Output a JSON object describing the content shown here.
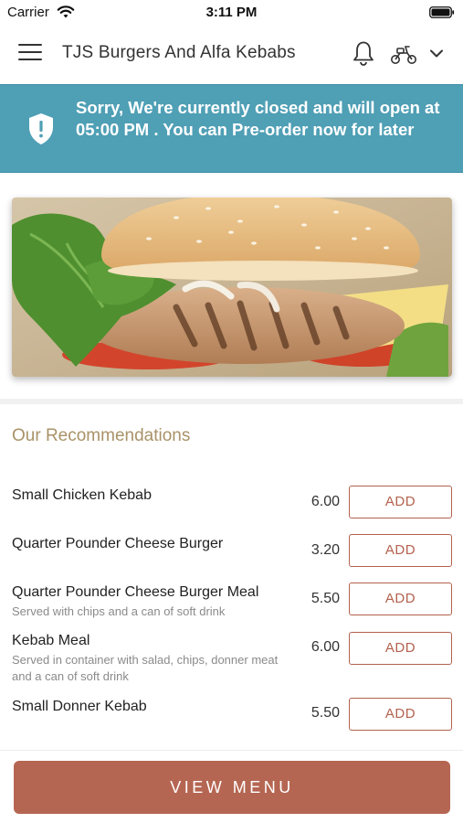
{
  "status_bar": {
    "carrier": "Carrier",
    "time": "3:11 PM",
    "icons": [
      "wifi-icon",
      "battery-icon"
    ]
  },
  "nav": {
    "title": "TJS Burgers And Alfa Kebabs",
    "icons": [
      "menu-icon",
      "bell-icon",
      "scooter-icon",
      "chevron-down-icon"
    ]
  },
  "notice": {
    "text": "Sorry, We're currently closed and will open at 05:00 PM . You can Pre-order now for later",
    "icon": "shield-alert-icon",
    "background_color": "#4f9fb5"
  },
  "hero": {
    "image": "burger-photo"
  },
  "recommendations": {
    "title": "Our Recommendations",
    "items": [
      {
        "name": "Small Chicken Kebab",
        "description": "",
        "price": "6.00",
        "button": "ADD"
      },
      {
        "name": "Quarter Pounder Cheese Burger",
        "description": "",
        "price": "3.20",
        "button": "ADD"
      },
      {
        "name": "Quarter Pounder Cheese Burger Meal",
        "description": "Served with chips and a can of soft drink",
        "price": "5.50",
        "button": "ADD"
      },
      {
        "name": "Kebab Meal",
        "description": "Served in container with salad, chips, donner meat and a can of soft drink",
        "price": "6.00",
        "button": "ADD"
      },
      {
        "name": "Small Donner Kebab",
        "description": "",
        "price": "5.50",
        "button": "ADD"
      }
    ]
  },
  "footer": {
    "view_menu_label": "VIEW MENU",
    "accent_color": "#b56652"
  }
}
